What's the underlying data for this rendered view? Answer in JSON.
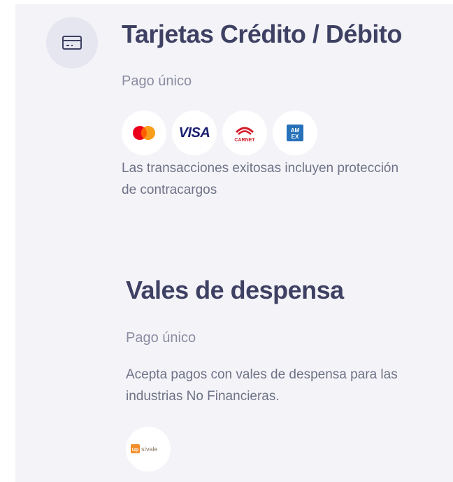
{
  "cards": {
    "title": "Tarjetas Crédito / Débito",
    "subtitle": "Pago único",
    "logos": [
      "mastercard",
      "VISA",
      "CARNET",
      "AMEX"
    ],
    "visa_label": "VISA",
    "carnet_label": "CARNET",
    "amex_label": "AM EX",
    "description": "Las transacciones exitosas incluyen protección de contracargos"
  },
  "vales": {
    "title": "Vales de despensa",
    "subtitle": "Pago único",
    "description": "Acepta pagos con vales de despensa para las industrias No Financieras.",
    "logo_label": "Up sí vale"
  },
  "colors": {
    "title": "#3e4163",
    "subtitle": "#8a8ca1",
    "text": "#6f7287",
    "panel": "#f4f4f8"
  }
}
